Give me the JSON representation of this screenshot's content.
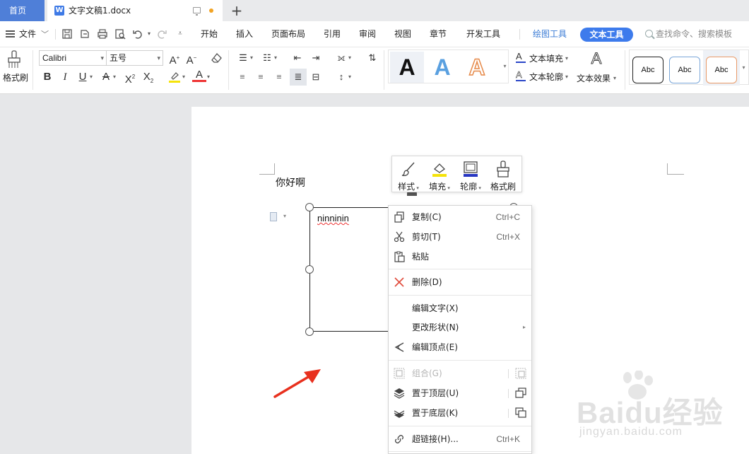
{
  "tabs": {
    "home": "首页",
    "document": "文字文稿1.docx",
    "add": "+"
  },
  "menubar": {
    "file": "文件",
    "tabs": [
      "开始",
      "插入",
      "页面布局",
      "引用",
      "审阅",
      "视图",
      "章节",
      "开发工具"
    ],
    "drawing_tools": "绘图工具",
    "text_tools": "文本工具",
    "search": "查找命令、搜索模板"
  },
  "ribbon": {
    "format_painter": "格式刷",
    "font_name": "Calibri",
    "font_size": "五号",
    "style_glyph": "A",
    "text_fill": "文本填充",
    "text_outline": "文本轮廓",
    "text_effect": "文本效果",
    "shape_styles": [
      "Abc",
      "Abc",
      "Abc"
    ]
  },
  "document": {
    "heading_text": "你好啊",
    "textbox_text": "ninninin"
  },
  "mini_toolbar": {
    "style": "样式",
    "fill": "填充",
    "outline": "轮廓",
    "format_painter": "格式刷"
  },
  "context_menu": {
    "items": [
      {
        "label": "复制(C)",
        "shortcut": "Ctrl+C"
      },
      {
        "label": "剪切(T)",
        "shortcut": "Ctrl+X"
      },
      {
        "label": "粘贴",
        "shortcut": ""
      },
      {
        "label": "删除(D)",
        "shortcut": ""
      },
      {
        "label": "编辑文字(X)",
        "shortcut": ""
      },
      {
        "label": "更改形状(N)",
        "shortcut": ""
      },
      {
        "label": "编辑顶点(E)",
        "shortcut": ""
      },
      {
        "label": "组合(G)",
        "shortcut": ""
      },
      {
        "label": "置于顶层(U)",
        "shortcut": ""
      },
      {
        "label": "置于底层(K)",
        "shortcut": ""
      },
      {
        "label": "超链接(H)...",
        "shortcut": "Ctrl+K"
      }
    ]
  },
  "colors": {
    "accent": "#3d7bec",
    "home_tab": "#4f7fd8",
    "delete_red": "#e04a3a",
    "arrow_red": "#e8301e"
  },
  "watermark": {
    "logo": "Baidu经验",
    "url": "jingyan.baidu.com"
  }
}
